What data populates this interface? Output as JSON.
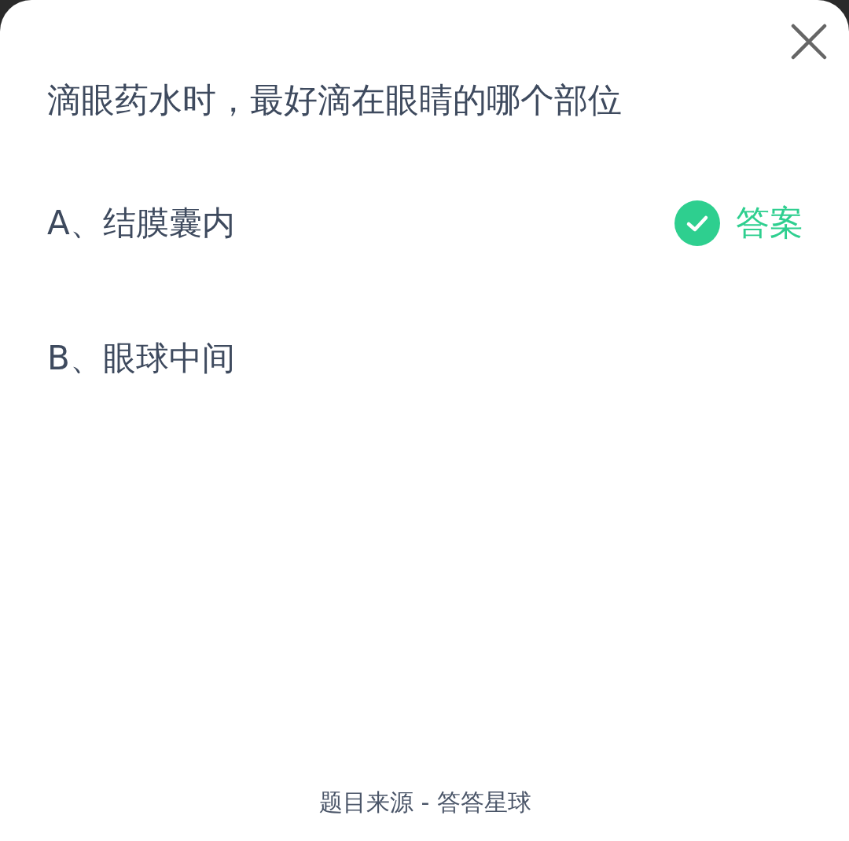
{
  "question": "滴眼药水时，最好滴在眼睛的哪个部位",
  "options": [
    {
      "label": "A、结膜囊内",
      "correct": true
    },
    {
      "label": "B、眼球中间",
      "correct": false
    }
  ],
  "answer_label": "答案",
  "footer": "题目来源 - 答答星球"
}
